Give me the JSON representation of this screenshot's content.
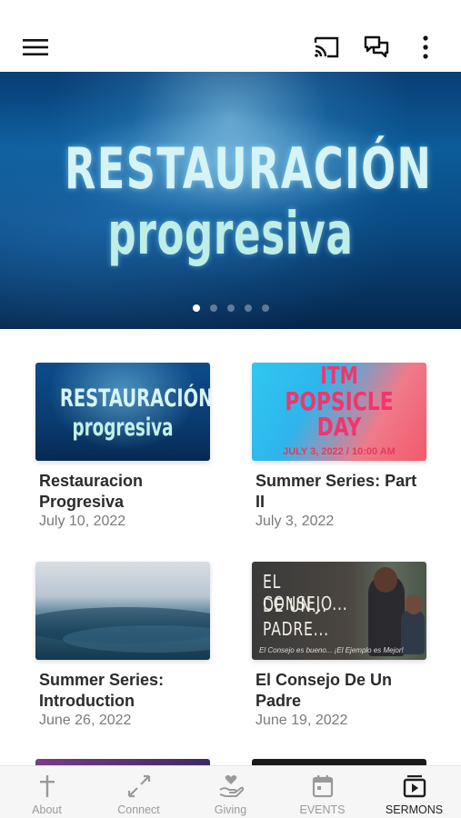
{
  "status": {
    "text": ""
  },
  "topbar": {
    "menu_icon": "hamburger-icon",
    "cast_icon": "cast-icon",
    "chat_icon": "chat-bubbles-icon",
    "more_icon": "more-vertical-icon"
  },
  "hero": {
    "line1": "RESTAURACIÓN",
    "line2": "progresiva",
    "carousel_pages": 5,
    "carousel_active": 1
  },
  "sermons": [
    {
      "title": "Restauracion Progresiva",
      "date": "July 10, 2022",
      "thumb": {
        "line1": "RESTAURACIÓN",
        "line2": "progresiva"
      }
    },
    {
      "title": "Summer Series: Part II",
      "date": "July 3, 2022",
      "thumb": {
        "line1": "ITM",
        "line2": "POPSICLE",
        "line3": "DAY",
        "footer": "JULY 3, 2022 / 10:00 AM"
      }
    },
    {
      "title": "Summer Series: Introduction",
      "date": "June 26, 2022",
      "thumb": {}
    },
    {
      "title": "El Consejo De Un Padre",
      "date": "June 19, 2022",
      "thumb": {
        "line1": "EL CONSEJO...",
        "line2": "DE UN...",
        "line3": "PADRE...",
        "caption": "El Consejo es bueno... ¡El Ejemplo es Mejor!"
      }
    }
  ],
  "bottom_nav": [
    {
      "label": "About",
      "icon": "cross-icon",
      "active": false
    },
    {
      "label": "Connect",
      "icon": "connect-arrows-icon",
      "active": false
    },
    {
      "label": "Giving",
      "icon": "heart-hand-icon",
      "active": false
    },
    {
      "label": "EVENTS",
      "icon": "calendar-icon",
      "active": false
    },
    {
      "label": "SERMONS",
      "icon": "video-library-icon",
      "active": true
    }
  ],
  "colors": {
    "accent_active": "#1f1f1f",
    "nav_inactive": "#9a9a9a",
    "popsicle_pink": "#f2356b"
  }
}
